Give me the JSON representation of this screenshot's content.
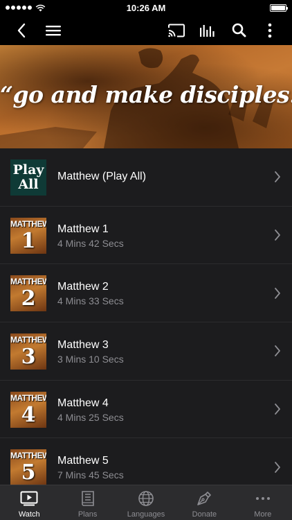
{
  "status_bar": {
    "time": "10:26 AM"
  },
  "banner": {
    "quote": "“go and make disciples...”"
  },
  "play_all": {
    "thumb_line1": "Play",
    "thumb_line2": "All",
    "title": "Matthew (Play All)"
  },
  "episodes": [
    {
      "thumb_title": "MATTHEW",
      "thumb_number": "1",
      "title": "Matthew 1",
      "duration": "4 Mins 42 Secs"
    },
    {
      "thumb_title": "MATTHEW",
      "thumb_number": "2",
      "title": "Matthew 2",
      "duration": "4 Mins 33 Secs"
    },
    {
      "thumb_title": "MATTHEW",
      "thumb_number": "3",
      "title": "Matthew 3",
      "duration": "3 Mins 10 Secs"
    },
    {
      "thumb_title": "MATTHEW",
      "thumb_number": "4",
      "title": "Matthew 4",
      "duration": "4 Mins 25 Secs"
    },
    {
      "thumb_title": "MATTHEW",
      "thumb_number": "5",
      "title": "Matthew 5",
      "duration": "7 Mins 45 Secs"
    }
  ],
  "tabs": [
    {
      "label": "Watch",
      "icon": "play-screen-icon",
      "active": true
    },
    {
      "label": "Plans",
      "icon": "book-icon",
      "active": false
    },
    {
      "label": "Languages",
      "icon": "globe-icon",
      "active": false
    },
    {
      "label": "Donate",
      "icon": "pen-nib-icon",
      "active": false
    },
    {
      "label": "More",
      "icon": "ellipsis-icon",
      "active": false
    }
  ],
  "colors": {
    "background": "#1c1c1e",
    "nav": "#000000",
    "tab_bar": "#2c2c2e",
    "secondary_text": "#8e8e93",
    "play_all_thumb": "#0f3a36"
  }
}
